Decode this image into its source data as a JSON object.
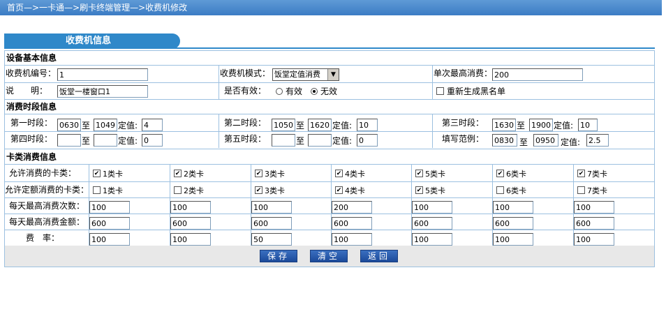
{
  "breadcrumb": "首页—>一卡通—>刷卡终端管理—>收费机修改",
  "tab_title": "收费机信息",
  "sections": {
    "basic": "设备基本信息",
    "periods": "消费时段信息",
    "card_types": "卡类消费信息"
  },
  "basic": {
    "machine_no_label": "收费机编号：",
    "machine_no_value": "1",
    "mode_label": "收费机模式：",
    "mode_value": "饭堂定值消费",
    "max_single_label": "单次最高消费：",
    "max_single_value": "200",
    "desc_label": "说　　明：",
    "desc_value": "饭堂一楼窗口1",
    "valid_label": "是否有效：",
    "valid_option": "有效",
    "invalid_option": "无效",
    "regen_label": "重新生成黑名单"
  },
  "periods": {
    "to": "至",
    "fixed": "定值:",
    "p1": {
      "label": "第一时段：",
      "start": "0630",
      "end": "1049",
      "value": "4"
    },
    "p2": {
      "label": "第二时段：",
      "start": "1050",
      "end": "1620",
      "value": "10"
    },
    "p3": {
      "label": "第三时段：",
      "start": "1630",
      "end": "1900",
      "value": "10"
    },
    "p4": {
      "label": "第四时段：",
      "start": "",
      "end": "",
      "value": "0"
    },
    "p5": {
      "label": "第五时段：",
      "start": "",
      "end": "",
      "value": "0"
    },
    "example": {
      "label": "填写范例：",
      "start": "0830",
      "end": "0950",
      "value": "2.5"
    }
  },
  "card_types": {
    "allowed_label": "允许消费的卡类：",
    "fixed_allowed_label": "允许定额消费的卡类：",
    "max_times_label": "每天最高消费次数：",
    "max_amount_label": "每天最高消费金额：",
    "rate_label": "费　率：",
    "cards": [
      "1类卡",
      "2类卡",
      "3类卡",
      "4类卡",
      "5类卡",
      "6类卡",
      "7类卡"
    ],
    "max_times": [
      "100",
      "100",
      "100",
      "200",
      "100",
      "100",
      "100"
    ],
    "max_amount": [
      "600",
      "600",
      "600",
      "600",
      "600",
      "600",
      "600"
    ],
    "rate": [
      "100",
      "100",
      "50",
      "100",
      "100",
      "100",
      "100"
    ]
  },
  "buttons": {
    "save": "保存",
    "clear": "清空",
    "back": "返回"
  }
}
